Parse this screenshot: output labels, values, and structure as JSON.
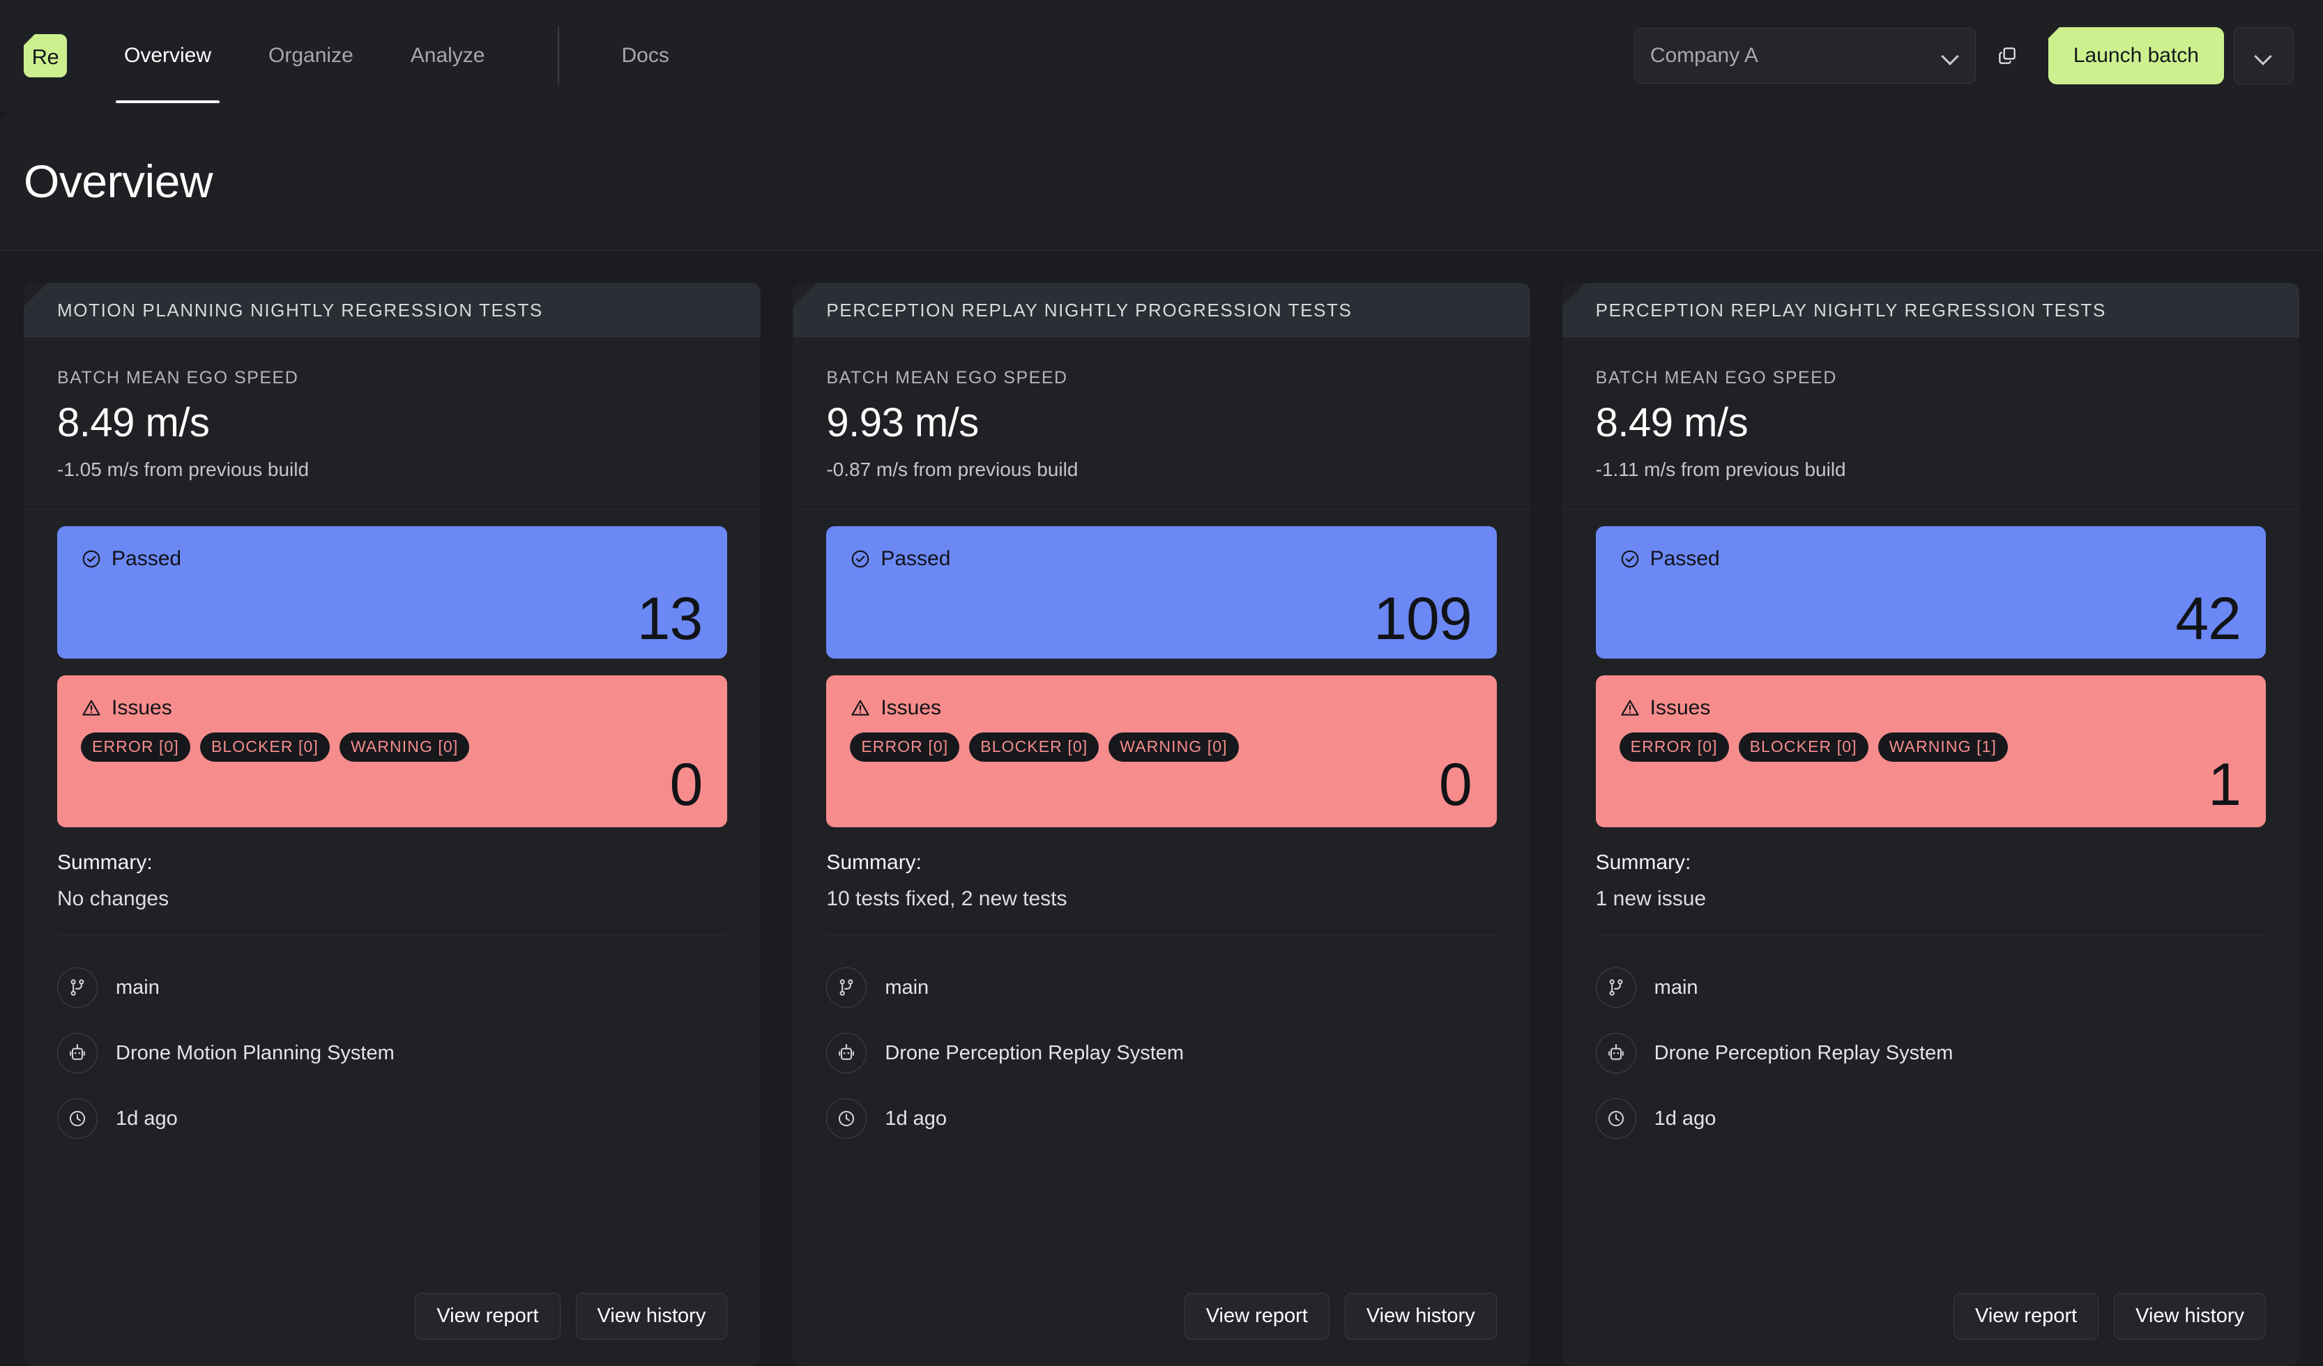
{
  "nav": {
    "logo_text": "Re",
    "tabs": [
      {
        "label": "Overview",
        "active": true
      },
      {
        "label": "Organize",
        "active": false
      },
      {
        "label": "Analyze",
        "active": false
      }
    ],
    "docs_label": "Docs",
    "org_selector_value": "Company A",
    "launch_button_label": "Launch batch"
  },
  "page": {
    "title": "Overview"
  },
  "colors": {
    "accent_green": "#cdf08f",
    "passed_blue": "#6b88f5",
    "issues_salmon": "#f78c8c",
    "page_bg": "#1b1c20",
    "card_bg": "#202125",
    "card_header_bg": "#2c2e35"
  },
  "labels": {
    "metric_label": "BATCH MEAN EGO SPEED",
    "passed_label": "Passed",
    "issues_label": "Issues",
    "summary_label": "Summary:",
    "view_report": "View report",
    "view_history": "View history"
  },
  "cards": [
    {
      "header": "MOTION PLANNING NIGHTLY REGRESSION TESTS",
      "metric_value": "8.49 m/s",
      "metric_delta": "-1.05 m/s from previous build",
      "passed_count": "13",
      "issues_count": "0",
      "chips": [
        "ERROR [0]",
        "BLOCKER [0]",
        "WARNING [0]"
      ],
      "summary_text": "No changes",
      "branch": "main",
      "system": "Drone Motion Planning System",
      "time": "1d ago"
    },
    {
      "header": "PERCEPTION REPLAY NIGHTLY PROGRESSION TESTS",
      "metric_value": "9.93 m/s",
      "metric_delta": "-0.87 m/s from previous build",
      "passed_count": "109",
      "issues_count": "0",
      "chips": [
        "ERROR [0]",
        "BLOCKER [0]",
        "WARNING [0]"
      ],
      "summary_text": "10 tests fixed, 2 new tests",
      "branch": "main",
      "system": "Drone Perception Replay System",
      "time": "1d ago"
    },
    {
      "header": "PERCEPTION REPLAY NIGHTLY REGRESSION TESTS",
      "metric_value": "8.49 m/s",
      "metric_delta": "-1.11 m/s from previous build",
      "passed_count": "42",
      "issues_count": "1",
      "chips": [
        "ERROR [0]",
        "BLOCKER [0]",
        "WARNING [1]"
      ],
      "summary_text": "1 new issue",
      "branch": "main",
      "system": "Drone Perception Replay System",
      "time": "1d ago"
    }
  ]
}
